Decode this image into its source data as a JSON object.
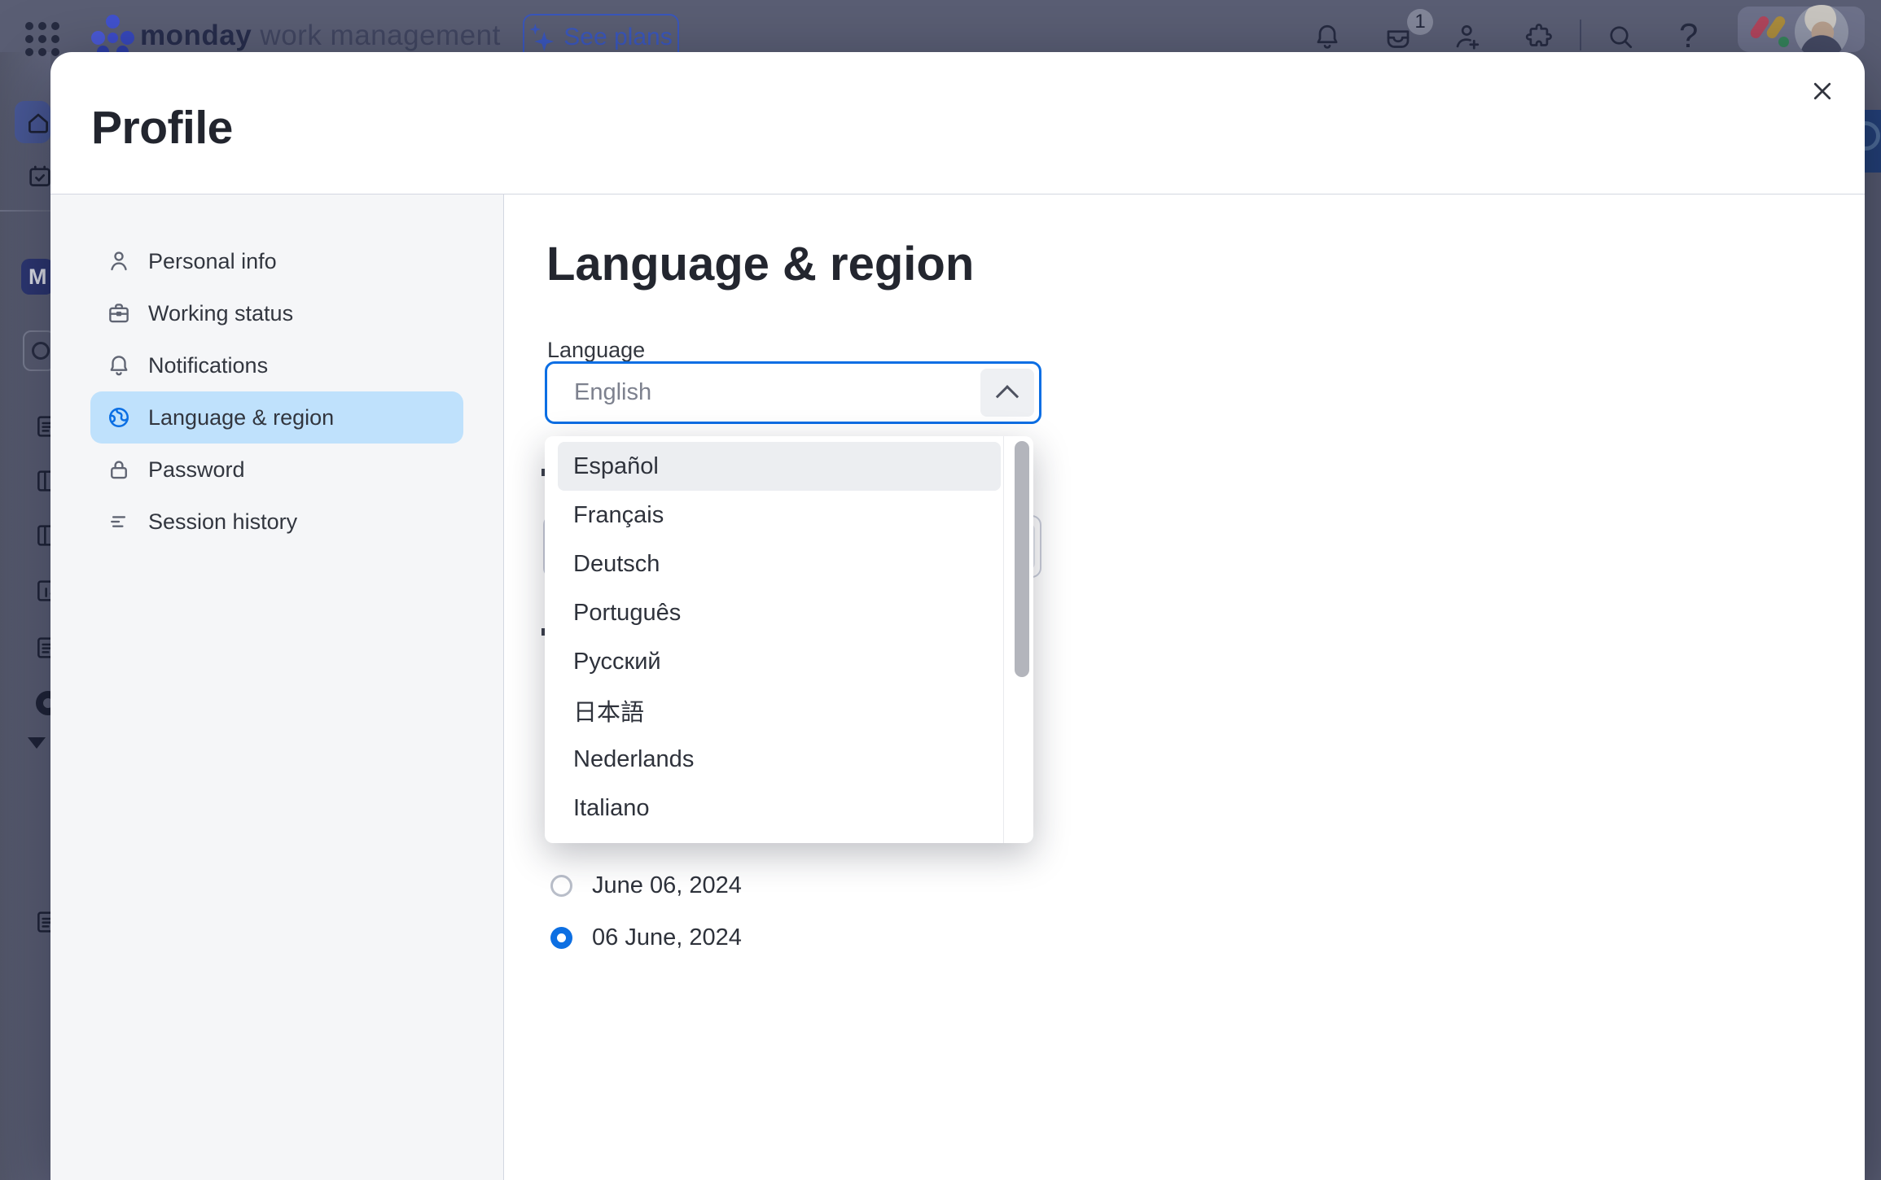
{
  "topbar": {
    "brand_bold": "monday",
    "brand_rest": " work management",
    "see_plans_label": "See plans",
    "inbox_badge": "1",
    "help_glyph": "?"
  },
  "leftnav": {
    "workspace_letter": "M"
  },
  "modal": {
    "title": "Profile",
    "sidebar": {
      "items": [
        {
          "label": "Personal info",
          "icon": "person-icon",
          "selected": false
        },
        {
          "label": "Working status",
          "icon": "briefcase-icon",
          "selected": false
        },
        {
          "label": "Notifications",
          "icon": "bell-icon",
          "selected": false
        },
        {
          "label": "Language & region",
          "icon": "globe-icon",
          "selected": true
        },
        {
          "label": "Password",
          "icon": "lock-icon",
          "selected": false
        },
        {
          "label": "Session history",
          "icon": "history-icon",
          "selected": false
        }
      ]
    },
    "content": {
      "heading": "Language & region",
      "language_label": "Language",
      "language_value": "English",
      "options": [
        {
          "label": "Español",
          "highlighted": true
        },
        {
          "label": "Français",
          "highlighted": false
        },
        {
          "label": "Deutsch",
          "highlighted": false
        },
        {
          "label": "Português",
          "highlighted": false
        },
        {
          "label": "Русский",
          "highlighted": false
        },
        {
          "label": "日本語",
          "highlighted": false
        },
        {
          "label": "Nederlands",
          "highlighted": false
        },
        {
          "label": "Italiano",
          "highlighted": false
        }
      ],
      "date_options": [
        {
          "label": "June 06, 2024",
          "selected": false
        },
        {
          "label": "06 June, 2024",
          "selected": true
        }
      ]
    }
  },
  "colors": {
    "accent_blue": "#0b6ee4",
    "sidebar_selected_bg": "#bfe1fc",
    "radio_selected": "#0d6fe2",
    "overlay_tone": "#5a5e74"
  }
}
